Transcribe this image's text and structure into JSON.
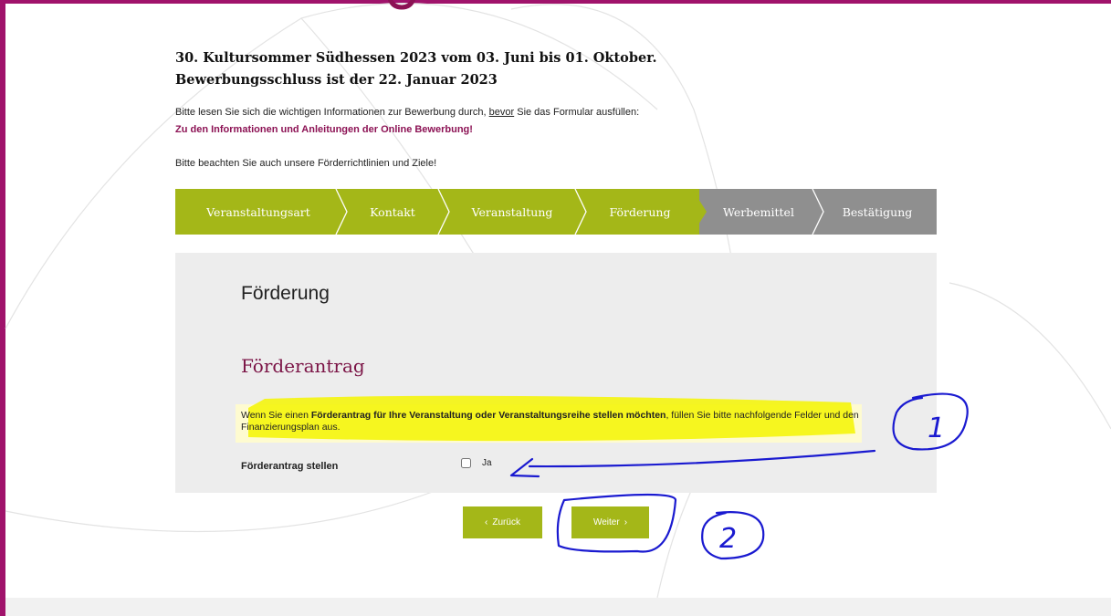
{
  "header": {
    "title_line1": "30. Kultursommer Südhessen 2023 vom 03. Juni bis 01. Oktober.",
    "title_line2": "Bewerbungsschluss ist der 22. Januar 2023",
    "intro_before": "Bitte lesen Sie sich die wichtigen Informationen zur Bewerbung durch, ",
    "intro_underlined": "bevor",
    "intro_after": " Sie das Formular ausfüllen:",
    "info_link": "Zu den Informationen und Anleitungen der Online Bewerbung!",
    "note": "Bitte beachten Sie auch unsere Förderrichtlinien und Ziele!"
  },
  "steps": [
    {
      "label": "Veranstaltungsart",
      "state": "done"
    },
    {
      "label": "Kontakt",
      "state": "done"
    },
    {
      "label": "Veranstaltung",
      "state": "done"
    },
    {
      "label": "Förderung",
      "state": "current"
    },
    {
      "label": "Werbemittel",
      "state": "todo"
    },
    {
      "label": "Bestätigung",
      "state": "todo"
    }
  ],
  "panel": {
    "heading": "Förderung",
    "subheading": "Förderantrag",
    "text_1": "Wenn Sie einen ",
    "text_bold": "Förderantrag für Ihre Veranstaltung oder Veranstaltungsreihe stellen möchten",
    "text_2": ", füllen Sie bitte nachfolgende Felder und den Finanzierungsplan aus.",
    "field_label": "Förderantrag stellen",
    "checkbox_label": "Ja",
    "checkbox_checked": false
  },
  "buttons": {
    "back_label": "Zurück",
    "next_label": "Weiter"
  },
  "annotations": {
    "mark_1": "1",
    "mark_2": "2"
  },
  "colors": {
    "accent_green": "#a4b718",
    "inactive_grey": "#8f8f8f",
    "brand_purple": "#a0136b",
    "heading_purple": "#7b1446",
    "highlight_yellow": "#f4f500",
    "annotation_blue": "#1a1ad0"
  }
}
